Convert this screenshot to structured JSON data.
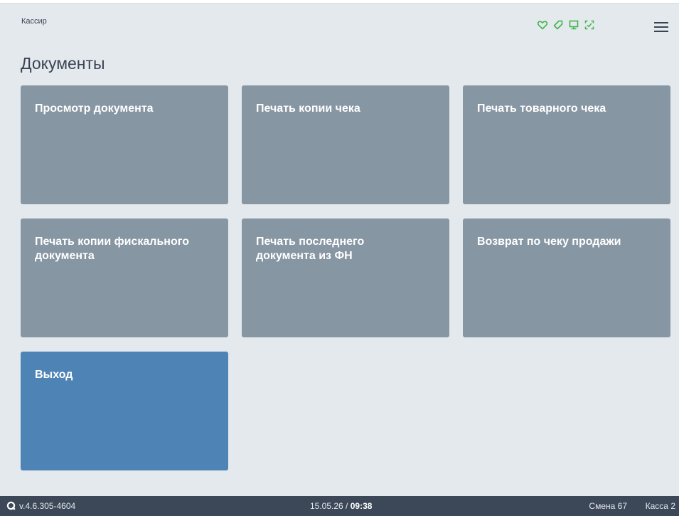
{
  "header": {
    "role": "Кассир",
    "status_icons": [
      "heart-icon",
      "tag-icon",
      "terminal-icon",
      "scanner-icon"
    ],
    "accent_color": "#3fb54a",
    "menu_icon": "hamburger-menu-icon"
  },
  "page": {
    "title": "Документы"
  },
  "tiles": [
    {
      "label": "Просмотр документа"
    },
    {
      "label": "Печать копии чека"
    },
    {
      "label": "Печать товарного чека"
    },
    {
      "label": "Печать копии фискального документа"
    },
    {
      "label": "Печать последнего документа из ФН"
    },
    {
      "label": "Возврат по чеку продажи"
    },
    {
      "label": "Выход"
    }
  ],
  "colors": {
    "tile": "#8796a3",
    "tile_primary": "#4e84b5",
    "background": "#e4e9ee",
    "footer": "#3c4758"
  },
  "footer": {
    "version": "v.4.6.305-4604",
    "date": "15.05.26",
    "separator": " / ",
    "time": "09:38",
    "shift": "Смена 67",
    "register": "Касса 2"
  }
}
